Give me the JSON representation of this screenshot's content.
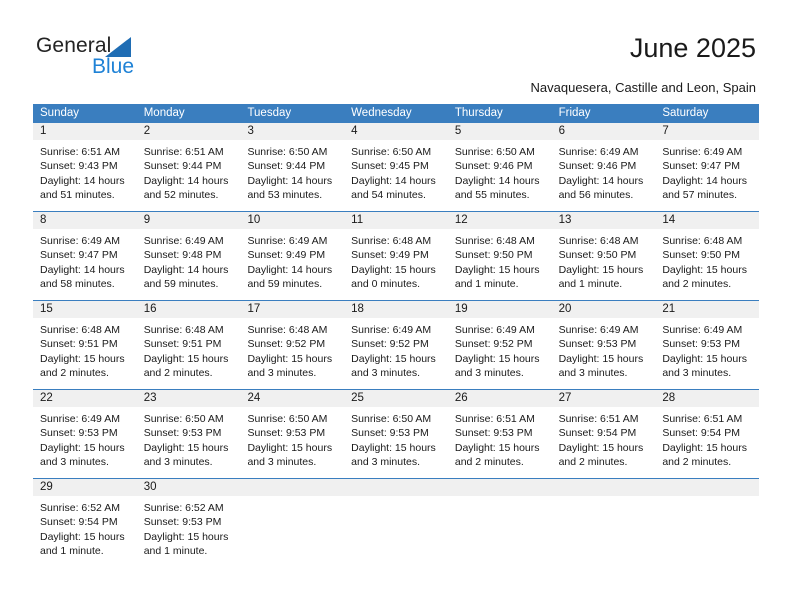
{
  "brand": {
    "name_part1": "General",
    "name_part2": "Blue",
    "accent_color": "#1f82d6",
    "triangle_color": "#1f6db4"
  },
  "header": {
    "title": "June 2025",
    "subtitle": "Navaquesera, Castille and Leon, Spain"
  },
  "calendar": {
    "header_color": "#3a7ebf",
    "daynum_band_color": "#f0f0f0",
    "weekdays": [
      "Sunday",
      "Monday",
      "Tuesday",
      "Wednesday",
      "Thursday",
      "Friday",
      "Saturday"
    ],
    "weeks": [
      [
        {
          "day": "1",
          "sunrise": "Sunrise: 6:51 AM",
          "sunset": "Sunset: 9:43 PM",
          "daylight1": "Daylight: 14 hours",
          "daylight2": "and 51 minutes."
        },
        {
          "day": "2",
          "sunrise": "Sunrise: 6:51 AM",
          "sunset": "Sunset: 9:44 PM",
          "daylight1": "Daylight: 14 hours",
          "daylight2": "and 52 minutes."
        },
        {
          "day": "3",
          "sunrise": "Sunrise: 6:50 AM",
          "sunset": "Sunset: 9:44 PM",
          "daylight1": "Daylight: 14 hours",
          "daylight2": "and 53 minutes."
        },
        {
          "day": "4",
          "sunrise": "Sunrise: 6:50 AM",
          "sunset": "Sunset: 9:45 PM",
          "daylight1": "Daylight: 14 hours",
          "daylight2": "and 54 minutes."
        },
        {
          "day": "5",
          "sunrise": "Sunrise: 6:50 AM",
          "sunset": "Sunset: 9:46 PM",
          "daylight1": "Daylight: 14 hours",
          "daylight2": "and 55 minutes."
        },
        {
          "day": "6",
          "sunrise": "Sunrise: 6:49 AM",
          "sunset": "Sunset: 9:46 PM",
          "daylight1": "Daylight: 14 hours",
          "daylight2": "and 56 minutes."
        },
        {
          "day": "7",
          "sunrise": "Sunrise: 6:49 AM",
          "sunset": "Sunset: 9:47 PM",
          "daylight1": "Daylight: 14 hours",
          "daylight2": "and 57 minutes."
        }
      ],
      [
        {
          "day": "8",
          "sunrise": "Sunrise: 6:49 AM",
          "sunset": "Sunset: 9:47 PM",
          "daylight1": "Daylight: 14 hours",
          "daylight2": "and 58 minutes."
        },
        {
          "day": "9",
          "sunrise": "Sunrise: 6:49 AM",
          "sunset": "Sunset: 9:48 PM",
          "daylight1": "Daylight: 14 hours",
          "daylight2": "and 59 minutes."
        },
        {
          "day": "10",
          "sunrise": "Sunrise: 6:49 AM",
          "sunset": "Sunset: 9:49 PM",
          "daylight1": "Daylight: 14 hours",
          "daylight2": "and 59 minutes."
        },
        {
          "day": "11",
          "sunrise": "Sunrise: 6:48 AM",
          "sunset": "Sunset: 9:49 PM",
          "daylight1": "Daylight: 15 hours",
          "daylight2": "and 0 minutes."
        },
        {
          "day": "12",
          "sunrise": "Sunrise: 6:48 AM",
          "sunset": "Sunset: 9:50 PM",
          "daylight1": "Daylight: 15 hours",
          "daylight2": "and 1 minute."
        },
        {
          "day": "13",
          "sunrise": "Sunrise: 6:48 AM",
          "sunset": "Sunset: 9:50 PM",
          "daylight1": "Daylight: 15 hours",
          "daylight2": "and 1 minute."
        },
        {
          "day": "14",
          "sunrise": "Sunrise: 6:48 AM",
          "sunset": "Sunset: 9:50 PM",
          "daylight1": "Daylight: 15 hours",
          "daylight2": "and 2 minutes."
        }
      ],
      [
        {
          "day": "15",
          "sunrise": "Sunrise: 6:48 AM",
          "sunset": "Sunset: 9:51 PM",
          "daylight1": "Daylight: 15 hours",
          "daylight2": "and 2 minutes."
        },
        {
          "day": "16",
          "sunrise": "Sunrise: 6:48 AM",
          "sunset": "Sunset: 9:51 PM",
          "daylight1": "Daylight: 15 hours",
          "daylight2": "and 2 minutes."
        },
        {
          "day": "17",
          "sunrise": "Sunrise: 6:48 AM",
          "sunset": "Sunset: 9:52 PM",
          "daylight1": "Daylight: 15 hours",
          "daylight2": "and 3 minutes."
        },
        {
          "day": "18",
          "sunrise": "Sunrise: 6:49 AM",
          "sunset": "Sunset: 9:52 PM",
          "daylight1": "Daylight: 15 hours",
          "daylight2": "and 3 minutes."
        },
        {
          "day": "19",
          "sunrise": "Sunrise: 6:49 AM",
          "sunset": "Sunset: 9:52 PM",
          "daylight1": "Daylight: 15 hours",
          "daylight2": "and 3 minutes."
        },
        {
          "day": "20",
          "sunrise": "Sunrise: 6:49 AM",
          "sunset": "Sunset: 9:53 PM",
          "daylight1": "Daylight: 15 hours",
          "daylight2": "and 3 minutes."
        },
        {
          "day": "21",
          "sunrise": "Sunrise: 6:49 AM",
          "sunset": "Sunset: 9:53 PM",
          "daylight1": "Daylight: 15 hours",
          "daylight2": "and 3 minutes."
        }
      ],
      [
        {
          "day": "22",
          "sunrise": "Sunrise: 6:49 AM",
          "sunset": "Sunset: 9:53 PM",
          "daylight1": "Daylight: 15 hours",
          "daylight2": "and 3 minutes."
        },
        {
          "day": "23",
          "sunrise": "Sunrise: 6:50 AM",
          "sunset": "Sunset: 9:53 PM",
          "daylight1": "Daylight: 15 hours",
          "daylight2": "and 3 minutes."
        },
        {
          "day": "24",
          "sunrise": "Sunrise: 6:50 AM",
          "sunset": "Sunset: 9:53 PM",
          "daylight1": "Daylight: 15 hours",
          "daylight2": "and 3 minutes."
        },
        {
          "day": "25",
          "sunrise": "Sunrise: 6:50 AM",
          "sunset": "Sunset: 9:53 PM",
          "daylight1": "Daylight: 15 hours",
          "daylight2": "and 3 minutes."
        },
        {
          "day": "26",
          "sunrise": "Sunrise: 6:51 AM",
          "sunset": "Sunset: 9:53 PM",
          "daylight1": "Daylight: 15 hours",
          "daylight2": "and 2 minutes."
        },
        {
          "day": "27",
          "sunrise": "Sunrise: 6:51 AM",
          "sunset": "Sunset: 9:54 PM",
          "daylight1": "Daylight: 15 hours",
          "daylight2": "and 2 minutes."
        },
        {
          "day": "28",
          "sunrise": "Sunrise: 6:51 AM",
          "sunset": "Sunset: 9:54 PM",
          "daylight1": "Daylight: 15 hours",
          "daylight2": "and 2 minutes."
        }
      ],
      [
        {
          "day": "29",
          "sunrise": "Sunrise: 6:52 AM",
          "sunset": "Sunset: 9:54 PM",
          "daylight1": "Daylight: 15 hours",
          "daylight2": "and 1 minute."
        },
        {
          "day": "30",
          "sunrise": "Sunrise: 6:52 AM",
          "sunset": "Sunset: 9:53 PM",
          "daylight1": "Daylight: 15 hours",
          "daylight2": "and 1 minute."
        },
        {
          "day": "",
          "sunrise": "",
          "sunset": "",
          "daylight1": "",
          "daylight2": ""
        },
        {
          "day": "",
          "sunrise": "",
          "sunset": "",
          "daylight1": "",
          "daylight2": ""
        },
        {
          "day": "",
          "sunrise": "",
          "sunset": "",
          "daylight1": "",
          "daylight2": ""
        },
        {
          "day": "",
          "sunrise": "",
          "sunset": "",
          "daylight1": "",
          "daylight2": ""
        },
        {
          "day": "",
          "sunrise": "",
          "sunset": "",
          "daylight1": "",
          "daylight2": ""
        }
      ]
    ]
  }
}
